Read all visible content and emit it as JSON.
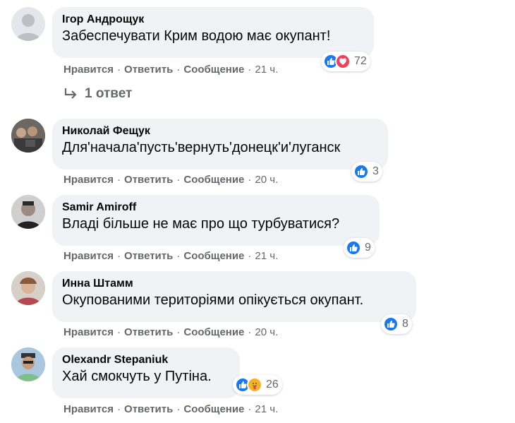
{
  "actions": {
    "like": "Нравится",
    "reply": "Ответить",
    "message": "Сообщение",
    "separator": "·"
  },
  "comments": [
    {
      "author": "Ігор Андрощук",
      "text": "Забеспечувати Крим водою має окупант!",
      "time": "21 ч.",
      "reactions": [
        "like",
        "love"
      ],
      "reaction_count": "72"
    },
    {
      "author": "Николай Фещук",
      "text": "Для'начала'пусть'вернуть'донецк'и'луганск",
      "time": "20 ч.",
      "reactions": [
        "like"
      ],
      "reaction_count": "3"
    },
    {
      "author": "Samir Amiroff",
      "text": "Владі більше не має про що турбуватися?",
      "time": "21 ч.",
      "reactions": [
        "like"
      ],
      "reaction_count": "9"
    },
    {
      "author": "Инна Штамм",
      "text": "Окупованими територіями опікується окупант.",
      "time": "20 ч.",
      "reactions": [
        "like"
      ],
      "reaction_count": "8"
    },
    {
      "author": "Olexandr Stepaniuk",
      "text": "Хай смокчуть у Путіна.",
      "time": "21 ч.",
      "reactions": [
        "like",
        "care"
      ],
      "reaction_count": "26"
    }
  ],
  "replies_link": "1 ответ",
  "colors": {
    "bubble": "#f0f2f5",
    "like": "#1877f2",
    "love": "#f33e58",
    "care": "#f7b125",
    "meta": "#65676b"
  }
}
